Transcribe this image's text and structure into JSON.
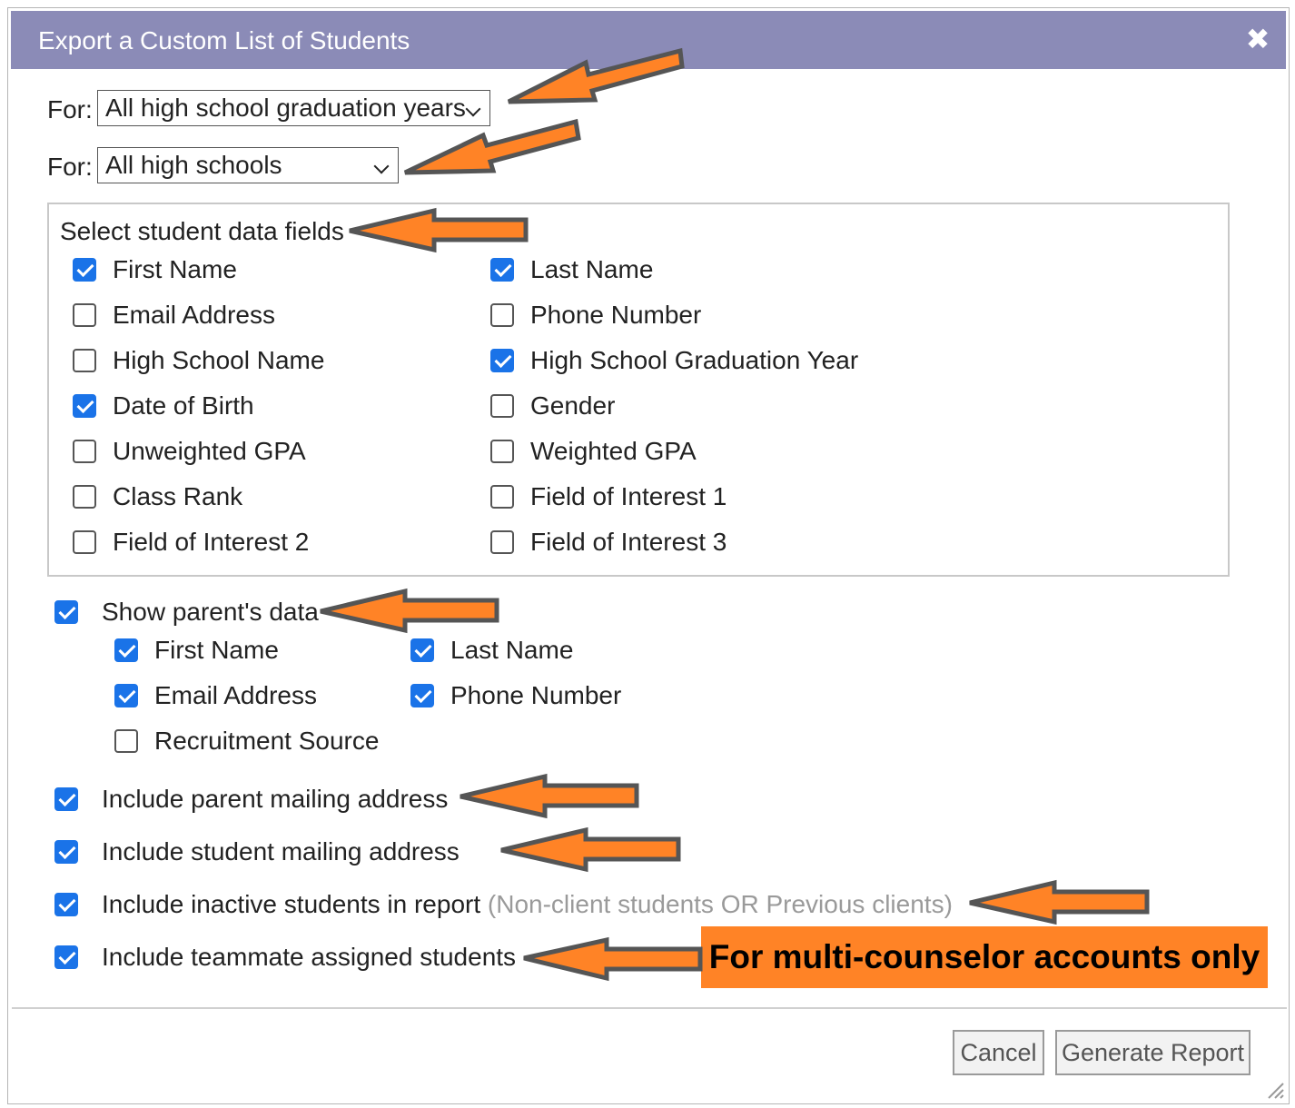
{
  "dialog": {
    "title": "Export a Custom List of Students",
    "close_icon": "close-icon"
  },
  "filters": [
    {
      "label": "For:",
      "value": "All high school graduation years"
    },
    {
      "label": "For:",
      "value": "All high schools"
    }
  ],
  "student_fields": {
    "legend": "Select student data fields",
    "items": [
      {
        "label": "First Name",
        "checked": true
      },
      {
        "label": "Last Name",
        "checked": true
      },
      {
        "label": "Email Address",
        "checked": false
      },
      {
        "label": "Phone Number",
        "checked": false
      },
      {
        "label": "High School Name",
        "checked": false
      },
      {
        "label": "High School Graduation Year",
        "checked": true
      },
      {
        "label": "Date of Birth",
        "checked": true
      },
      {
        "label": "Gender",
        "checked": false
      },
      {
        "label": "Unweighted GPA",
        "checked": false
      },
      {
        "label": "Weighted GPA",
        "checked": false
      },
      {
        "label": "Class Rank",
        "checked": false
      },
      {
        "label": "Field of Interest 1",
        "checked": false
      },
      {
        "label": "Field of Interest 2",
        "checked": false
      },
      {
        "label": "Field of Interest 3",
        "checked": false
      }
    ]
  },
  "parent": {
    "show_label": "Show parent's data",
    "show_checked": true,
    "items": [
      {
        "label": "First Name",
        "checked": true
      },
      {
        "label": "Last Name",
        "checked": true
      },
      {
        "label": "Email Address",
        "checked": true
      },
      {
        "label": "Phone Number",
        "checked": true
      },
      {
        "label": "Recruitment Source",
        "checked": false
      }
    ]
  },
  "options": [
    {
      "label": "Include parent mailing address",
      "checked": true,
      "note": ""
    },
    {
      "label": "Include student mailing address",
      "checked": true,
      "note": ""
    },
    {
      "label": "Include inactive students in report",
      "checked": true,
      "note": "(Non-client students OR Previous clients)"
    },
    {
      "label": "Include teammate assigned students",
      "checked": true,
      "note": ""
    }
  ],
  "callout": "For multi-counselor accounts only",
  "buttons": {
    "cancel": "Cancel",
    "generate": "Generate Report"
  },
  "colors": {
    "titlebar": "#8b8bb7",
    "checkbox": "#1a73e8",
    "arrow": "#ff8326",
    "callout": "#ff8326"
  }
}
